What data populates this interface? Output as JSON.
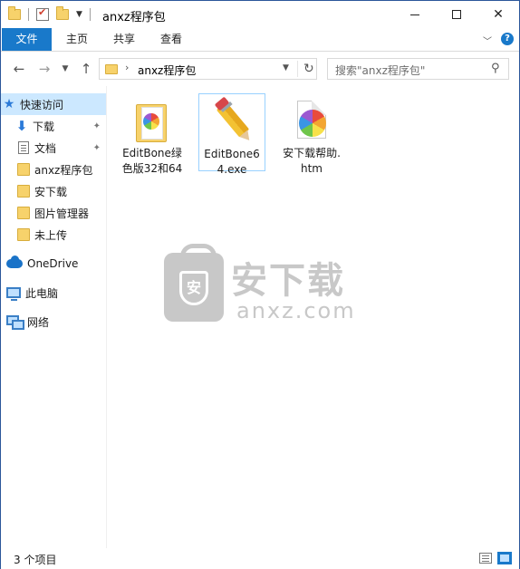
{
  "window": {
    "title": "anxz程序包"
  },
  "ribbon": {
    "tabs": [
      "文件",
      "主页",
      "共享",
      "查看"
    ]
  },
  "address": {
    "path": "anxz程序包",
    "search_placeholder": "搜索\"anxz程序包\""
  },
  "navpane": {
    "quick_access": "快速访问",
    "items": [
      {
        "label": "下载",
        "icon": "download-arrow-icon",
        "pinned": true
      },
      {
        "label": "文档",
        "icon": "document-icon",
        "pinned": true
      },
      {
        "label": "anxz程序包",
        "icon": "folder-icon",
        "pinned": false
      },
      {
        "label": "安下载",
        "icon": "folder-icon",
        "pinned": false
      },
      {
        "label": "图片管理器",
        "icon": "folder-icon",
        "pinned": false
      },
      {
        "label": "未上传",
        "icon": "folder-icon",
        "pinned": false
      }
    ],
    "onedrive": "OneDrive",
    "this_pc": "此电脑",
    "network": "网络"
  },
  "files": [
    {
      "name": "EditBone绿色版32和64",
      "icon": "folder-icon"
    },
    {
      "name": "EditBone64.exe",
      "icon": "pencil-exe-icon",
      "selected": true
    },
    {
      "name": "安下载帮助.htm",
      "icon": "htm-file-icon"
    }
  ],
  "watermark": {
    "cn": "安下载",
    "en": "anxz.com"
  },
  "statusbar": {
    "count": "3 个项目"
  }
}
